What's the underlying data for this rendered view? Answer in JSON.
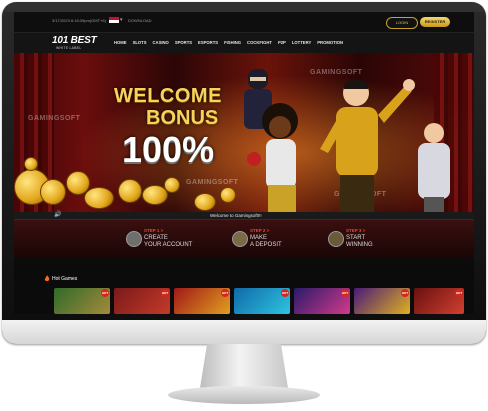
{
  "topbar": {
    "datetime": "3/17/2023 8:18:39pm(GMT+8)",
    "flag_arrow": "▾",
    "download": "DOWNLOAD",
    "login_label": "LOGIN",
    "register_label": "REGISTER"
  },
  "logo": {
    "big": "101 BEST",
    "small": "WHITE LABEL"
  },
  "nav": {
    "items": [
      "HOME",
      "SLOTS",
      "CASINO",
      "SPORTS",
      "ESPORTS",
      "FISHING",
      "COCKFIGHT",
      "P2P",
      "LOTTERY",
      "PROMOTION"
    ]
  },
  "banner": {
    "title_line1": "WELCOME",
    "title_line2": "BONUS",
    "title_line3": "100%",
    "watermark": "GAMINGSOFT",
    "ticker": "Welcome to Gamingsoft!!!",
    "sound_icon": "🔊"
  },
  "steps": [
    {
      "num": "STEP 1  >",
      "line1": "CREATE",
      "line2": "YOUR ACCOUNT"
    },
    {
      "num": "STEP 2  >",
      "line1": "MAKE",
      "line2": "A DEPOSIT"
    },
    {
      "num": "STEP 3  >",
      "line1": "START",
      "line2": "WINNING"
    }
  ],
  "hot_games": {
    "label": "Hot Games",
    "badge": "HOT"
  },
  "colors": {
    "accent_gold": "#f6d35a",
    "step_red": "#e34c2b",
    "banner_red": "#6b0d0d"
  }
}
